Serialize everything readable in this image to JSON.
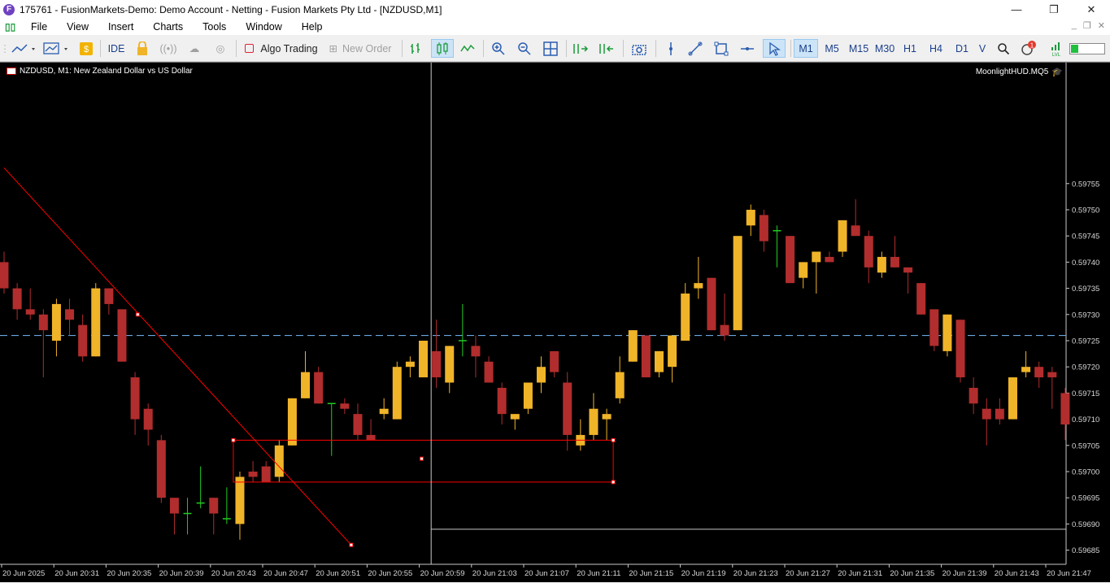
{
  "window": {
    "title": "175761 - FusionMarkets-Demo: Demo Account - Netting - Fusion Markets Pty Ltd - [NZDUSD,M1]",
    "app_icon_letter": "F",
    "minimize": "—",
    "maximize": "❐",
    "close": "✕"
  },
  "menu": {
    "items": [
      "File",
      "View",
      "Insert",
      "Charts",
      "Tools",
      "Window",
      "Help"
    ],
    "mdi_buttons": [
      "_",
      "❐",
      "✕"
    ]
  },
  "toolbar": {
    "ide": "IDE",
    "algo_trading": "Algo Trading",
    "new_order": "New Order",
    "notification_count": "1",
    "timeframes": [
      "M1",
      "M5",
      "M15",
      "M30",
      "H1",
      "H4",
      "D1",
      "V"
    ],
    "selected_timeframe": "M1"
  },
  "chart": {
    "symbol_label": "NZDUSD, M1:  New Zealand Dollar vs US Dollar",
    "indicator_label": "MoonlightHUD.MQ5",
    "background": "#000000",
    "bull_color": "#f0b429",
    "bear_color": "#b22d2d",
    "doji_color": "#22cc22",
    "line_color": "#ff0000",
    "bid_line_color": "#6aa6e0"
  },
  "chart_data": {
    "type": "candlestick",
    "symbol": "NZDUSD",
    "timeframe": "M1",
    "y_ticks": [
      "0.59755",
      "0.59750",
      "0.59745",
      "0.59740",
      "0.59735",
      "0.59730",
      "0.59725",
      "0.59720",
      "0.59715",
      "0.59710",
      "0.59705",
      "0.59700",
      "0.59695",
      "0.59690",
      "0.59685"
    ],
    "x_ticks": [
      "20 Jun 2025",
      "20 Jun 20:31",
      "20 Jun 20:35",
      "20 Jun 20:39",
      "20 Jun 20:43",
      "20 Jun 20:47",
      "20 Jun 20:51",
      "20 Jun 20:55",
      "20 Jun 20:59",
      "20 Jun 21:03",
      "20 Jun 21:07",
      "20 Jun 21:11",
      "20 Jun 21:15",
      "20 Jun 21:19",
      "20 Jun 21:23",
      "20 Jun 21:27",
      "20 Jun 21:31",
      "20 Jun 21:35",
      "20 Jun 21:39",
      "20 Jun 21:43",
      "20 Jun 21:47"
    ],
    "ylim": [
      0.596823,
      0.597781
    ],
    "bid_price": 0.59726,
    "candles": [
      [
        0.5974,
        0.59742,
        0.59734,
        0.59735
      ],
      [
        0.59735,
        0.59736,
        0.59729,
        0.59731
      ],
      [
        0.59731,
        0.59735,
        0.59729,
        0.5973
      ],
      [
        0.5973,
        0.59731,
        0.59718,
        0.59727
      ],
      [
        0.59725,
        0.59733,
        0.59722,
        0.59732
      ],
      [
        0.59731,
        0.59733,
        0.59726,
        0.59729
      ],
      [
        0.59728,
        0.5973,
        0.59721,
        0.59722
      ],
      [
        0.59722,
        0.59736,
        0.59722,
        0.59735
      ],
      [
        0.59735,
        0.59735,
        0.5973,
        0.59732
      ],
      [
        0.59731,
        0.59731,
        0.59721,
        0.59721
      ],
      [
        0.59718,
        0.59719,
        0.59707,
        0.5971
      ],
      [
        0.59712,
        0.59713,
        0.59705,
        0.59708
      ],
      [
        0.59706,
        0.59707,
        0.59694,
        0.59695
      ],
      [
        0.59695,
        0.59695,
        0.59688,
        0.59692
      ],
      [
        0.59692,
        0.59695,
        0.59688,
        0.59692
      ],
      [
        0.59694,
        0.59701,
        0.59693,
        0.59694
      ],
      [
        0.59695,
        0.59695,
        0.59688,
        0.59692
      ],
      [
        0.59691,
        0.59697,
        0.5969,
        0.59691
      ],
      [
        0.5969,
        0.597,
        0.59687,
        0.59699
      ],
      [
        0.597,
        0.59702,
        0.59698,
        0.59699
      ],
      [
        0.59701,
        0.59702,
        0.59698,
        0.59698
      ],
      [
        0.59699,
        0.59706,
        0.59698,
        0.59705
      ],
      [
        0.59705,
        0.59714,
        0.59705,
        0.59714
      ],
      [
        0.59714,
        0.59723,
        0.59714,
        0.59719
      ],
      [
        0.59719,
        0.5972,
        0.59713,
        0.59713
      ],
      [
        0.59713,
        0.59713,
        0.59703,
        0.59713
      ],
      [
        0.59713,
        0.59714,
        0.59711,
        0.59712
      ],
      [
        0.59711,
        0.59713,
        0.59706,
        0.59707
      ],
      [
        0.59707,
        0.5971,
        0.59706,
        0.59706
      ],
      [
        0.59711,
        0.59714,
        0.5971,
        0.59712
      ],
      [
        0.5971,
        0.59721,
        0.5971,
        0.5972
      ],
      [
        0.5972,
        0.59722,
        0.59718,
        0.59721
      ],
      [
        0.59718,
        0.59725,
        0.59718,
        0.59725
      ],
      [
        0.59723,
        0.59729,
        0.59716,
        0.59718
      ],
      [
        0.59717,
        0.59724,
        0.59715,
        0.59724
      ],
      [
        0.59725,
        0.59732,
        0.59722,
        0.59725
      ],
      [
        0.59724,
        0.59726,
        0.59718,
        0.59722
      ],
      [
        0.59721,
        0.59722,
        0.59717,
        0.59717
      ],
      [
        0.59716,
        0.59717,
        0.59709,
        0.59711
      ],
      [
        0.5971,
        0.59711,
        0.59708,
        0.59711
      ],
      [
        0.59712,
        0.59717,
        0.59711,
        0.59717
      ],
      [
        0.59717,
        0.59722,
        0.59715,
        0.5972
      ],
      [
        0.59723,
        0.59723,
        0.59718,
        0.59719
      ],
      [
        0.59717,
        0.59719,
        0.59704,
        0.59707
      ],
      [
        0.59705,
        0.5971,
        0.59704,
        0.59707
      ],
      [
        0.59707,
        0.59715,
        0.59706,
        0.59712
      ],
      [
        0.5971,
        0.59712,
        0.59706,
        0.59711
      ],
      [
        0.59714,
        0.59722,
        0.59713,
        0.59719
      ],
      [
        0.59721,
        0.59727,
        0.59721,
        0.59727
      ],
      [
        0.59726,
        0.59726,
        0.59718,
        0.59718
      ],
      [
        0.59719,
        0.59723,
        0.59718,
        0.59723
      ],
      [
        0.5972,
        0.59726,
        0.59717,
        0.59726
      ],
      [
        0.59725,
        0.59736,
        0.59725,
        0.59734
      ],
      [
        0.59735,
        0.59741,
        0.59733,
        0.59736
      ],
      [
        0.59737,
        0.59737,
        0.59727,
        0.59727
      ],
      [
        0.59728,
        0.59734,
        0.59725,
        0.59726
      ],
      [
        0.59727,
        0.59745,
        0.59727,
        0.59745
      ],
      [
        0.59747,
        0.59751,
        0.59745,
        0.5975
      ],
      [
        0.59749,
        0.5975,
        0.59742,
        0.59744
      ],
      [
        0.59746,
        0.59747,
        0.59739,
        0.59746
      ],
      [
        0.59745,
        0.59745,
        0.59736,
        0.59736
      ],
      [
        0.59737,
        0.5974,
        0.59735,
        0.5974
      ],
      [
        0.5974,
        0.59742,
        0.59734,
        0.59742
      ],
      [
        0.59741,
        0.59742,
        0.5974,
        0.5974
      ],
      [
        0.59742,
        0.59748,
        0.59741,
        0.59748
      ],
      [
        0.59747,
        0.59752,
        0.59745,
        0.59745
      ],
      [
        0.59745,
        0.59746,
        0.59736,
        0.59739
      ],
      [
        0.59738,
        0.59742,
        0.59737,
        0.59741
      ],
      [
        0.59741,
        0.59745,
        0.59739,
        0.59739
      ],
      [
        0.59739,
        0.59739,
        0.59734,
        0.59738
      ],
      [
        0.59736,
        0.59736,
        0.5973,
        0.5973
      ],
      [
        0.59731,
        0.59731,
        0.59723,
        0.59724
      ],
      [
        0.59723,
        0.5973,
        0.59722,
        0.5973
      ],
      [
        0.59729,
        0.59729,
        0.59717,
        0.59718
      ],
      [
        0.59716,
        0.59718,
        0.59711,
        0.59713
      ],
      [
        0.59712,
        0.59714,
        0.59705,
        0.5971
      ],
      [
        0.59712,
        0.59714,
        0.59709,
        0.5971
      ],
      [
        0.5971,
        0.59718,
        0.5971,
        0.59718
      ],
      [
        0.59719,
        0.59723,
        0.59718,
        0.5972
      ],
      [
        0.5972,
        0.59721,
        0.59716,
        0.59718
      ],
      [
        0.59719,
        0.5972,
        0.59712,
        0.59718
      ],
      [
        0.59715,
        0.59716,
        0.59706,
        0.59709
      ]
    ],
    "trendline": {
      "start": [
        0,
        0.59758
      ],
      "end": [
        26.5,
        0.59686
      ]
    },
    "rectangle": {
      "x_from": 17.5,
      "x_to": 46.5,
      "top": 0.59706,
      "bottom": 0.59698
    },
    "crosshair": {
      "x_index": 32.6,
      "price": 0.59689
    }
  }
}
